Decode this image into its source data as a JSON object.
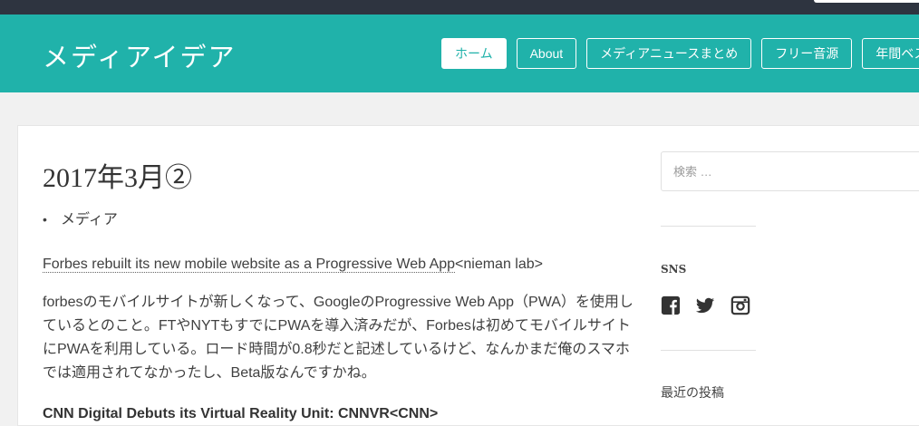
{
  "site": {
    "title": "メディアイデア"
  },
  "nav": {
    "items": [
      {
        "label": "ホーム",
        "active": true
      },
      {
        "label": "About"
      },
      {
        "label": "メディアニュースまとめ"
      },
      {
        "label": "フリー音源"
      },
      {
        "label": "年間ベス"
      }
    ]
  },
  "post": {
    "title": "2017年3月②",
    "category": "メディア",
    "link1_text": "Forbes rebuilt its new mobile website as a Progressive Web App",
    "link1_source": "<nieman lab>",
    "paragraph1": "forbesのモバイルサイトが新しくなって、GoogleのProgressive Web App（PWA）を使用しているとのこと。FTやNYTもすでにPWAを導入済みだが、Forbesは初めてモバイルサイトにPWAを利用している。ロード時間が0.8秒だと記述しているけど、なんかまだ俺のスマホでは適用されてなかったし、Beta版なんですかね。",
    "heading2": "CNN Digital Debuts its Virtual Reality Unit: CNNVR<CNN>"
  },
  "sidebar": {
    "search_placeholder": "検索 …",
    "sns_title": "SNS",
    "sns_icons": [
      "facebook-icon",
      "twitter-icon",
      "instagram-icon"
    ],
    "recent_title": "最近の投稿"
  },
  "colors": {
    "header_bg": "#20b2aa",
    "topbar_bg": "#2e3440",
    "icon_color": "#333333"
  }
}
